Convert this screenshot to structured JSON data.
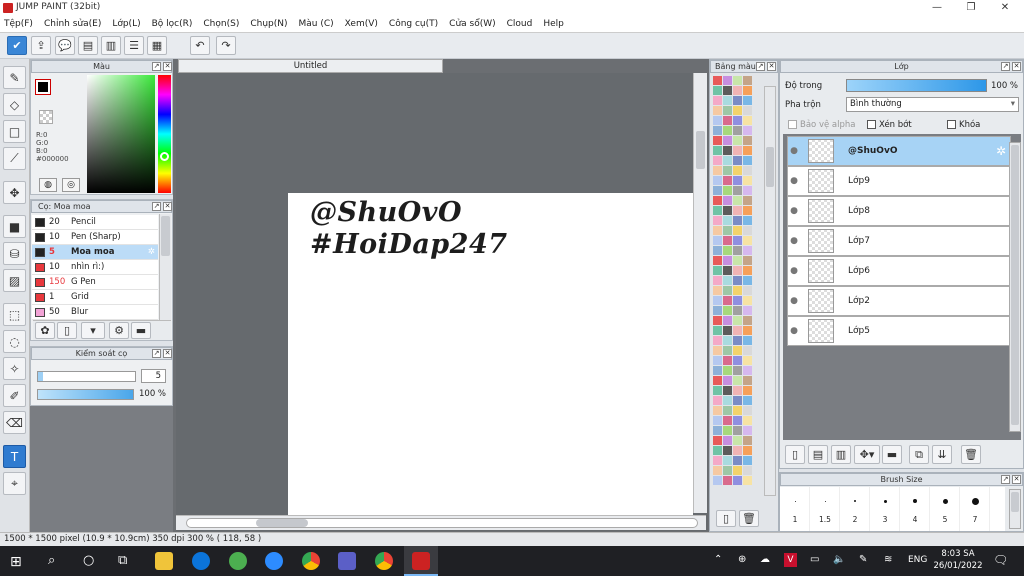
{
  "window": {
    "title": "JUMP PAINT (32bit)"
  },
  "menu": [
    "Tệp(F)",
    "Chỉnh sửa(E)",
    "Lớp(L)",
    "Bộ lọc(R)",
    "Chọn(S)",
    "Chụp(N)",
    "Màu (C)",
    "Xem(V)",
    "Công cụ(T)",
    "Cửa sổ(W)",
    "Cloud",
    "Help"
  ],
  "panels": {
    "color": {
      "title": "Màu",
      "r": "R:0",
      "g": "G:0",
      "b": "B:0",
      "hex": "#000000"
    },
    "brush": {
      "title": "Cọ: Moa moa",
      "items": [
        {
          "size": "20",
          "name": "Pencil",
          "color": "#222222"
        },
        {
          "size": "10",
          "name": "Pen (Sharp)",
          "color": "#222222"
        },
        {
          "size": "5",
          "name": "Moa moa",
          "color": "#222222",
          "selected": true
        },
        {
          "size": "10",
          "name": "nhìn rì:)",
          "color": "#e8383d"
        },
        {
          "size": "150",
          "name": "G Pen",
          "color": "#e8383d"
        },
        {
          "size": "1",
          "name": "Grid",
          "color": "#e8383d"
        },
        {
          "size": "50",
          "name": "Blur",
          "color": "#f2a3d6"
        }
      ]
    },
    "brush_control": {
      "title": "Kiểm soát cọ",
      "size_value": "5",
      "opacity_label": "100 %",
      "size_level": 0.05,
      "opacity_level": 1.0
    },
    "palette": {
      "title": "Bảng màu"
    },
    "layer": {
      "title": "Lớp",
      "opacity_label": "Độ trong",
      "opacity_value": "100 %",
      "opacity_level": 1.0,
      "blend_label": "Pha trộn",
      "blend_value": "Bình thường",
      "protect_alpha": "Bảo vệ alpha",
      "clip": "Xén bớt",
      "lock": "Khóa",
      "layers": [
        {
          "name": "@ShuOvO",
          "selected": true
        },
        {
          "name": "Lớp9"
        },
        {
          "name": "Lớp8"
        },
        {
          "name": "Lớp7"
        },
        {
          "name": "Lớp6"
        },
        {
          "name": "Lớp2"
        },
        {
          "name": "Lớp5"
        }
      ]
    },
    "brush_size": {
      "title": "Brush Size",
      "sizes": [
        "1",
        "1.5",
        "2",
        "3",
        "4",
        "5",
        "7"
      ]
    }
  },
  "document": {
    "tab": "Untitled",
    "line1": "@ShuOvO",
    "line2": "#HoiDap247"
  },
  "status": {
    "text": "1500 * 1500 pixel   (10.9 * 10.9cm)   350 dpi   300 %   ( 118, 58 )"
  },
  "taskbar": {
    "lang": "ENG",
    "time": "8:03 SA",
    "date": "26/01/2022"
  },
  "colors": {
    "accent": "#3a86d6",
    "selected_layer": "#a7d3f5",
    "canvas_bg": "#6b6e72"
  }
}
